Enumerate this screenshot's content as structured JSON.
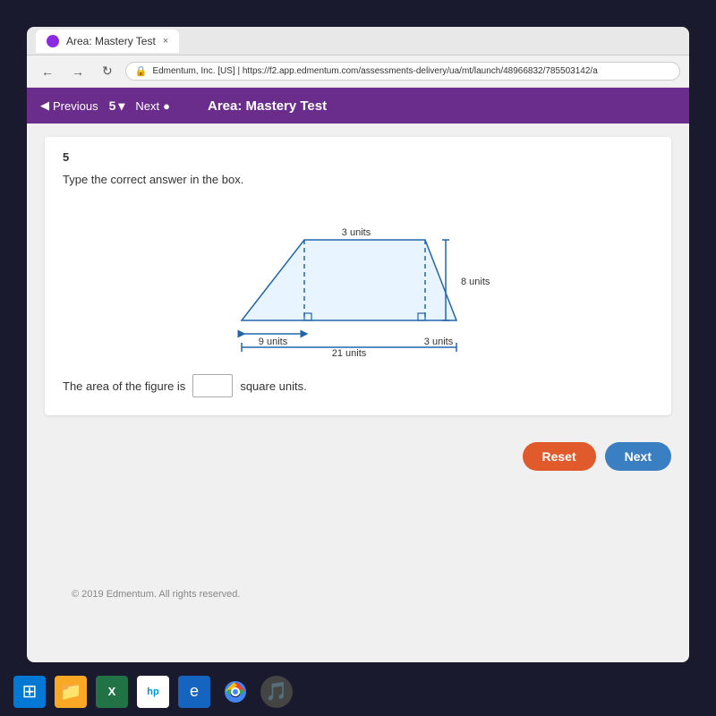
{
  "browser": {
    "tab_title": "Area: Mastery Test",
    "tab_close": "×",
    "address": "https://f2.app.edmentum.com/assessments-delivery/ua/mt/launch/48966832/785503142/a",
    "address_display": "Edmentum, Inc. [US] | https://f2.app.edmentum.com/assessments-delivery/ua/mt/launch/48966832/785503142/a"
  },
  "app_header": {
    "previous_label": "Previous",
    "question_num": "5",
    "dropdown_icon": "▾",
    "next_label": "Next",
    "next_icon": "●",
    "title": "Area: Mastery Test"
  },
  "question": {
    "number": "5",
    "instruction": "Type the correct answer in the box.",
    "answer_prefix": "The area of the figure is",
    "answer_suffix": "square units.",
    "answer_placeholder": ""
  },
  "figure": {
    "labels": {
      "top": "3 units",
      "right": "8 units",
      "bottom_left": "9 units",
      "bottom_total": "21 units",
      "bottom_right": "3 units"
    }
  },
  "buttons": {
    "reset_label": "Reset",
    "next_label": "Next"
  },
  "footer": {
    "copyright": "© 2019 Edmentum. All rights reserved."
  },
  "taskbar": {
    "icons": [
      "⊞",
      "📁",
      "⊞",
      "hp",
      "e",
      "◉",
      "♪"
    ]
  }
}
